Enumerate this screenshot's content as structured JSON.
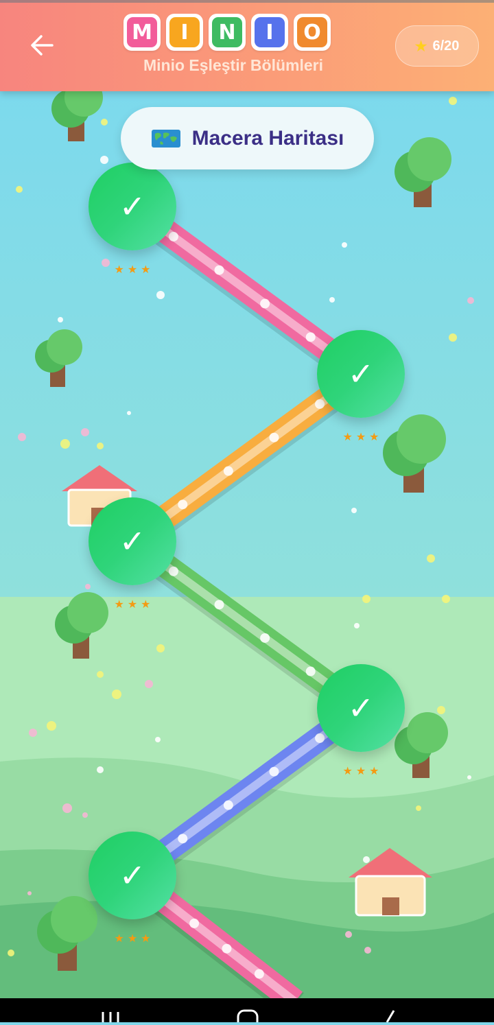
{
  "header": {
    "back_icon": "arrow-left-icon",
    "logo_letters": [
      {
        "letter": "M",
        "color": "#f25c9a"
      },
      {
        "letter": "I",
        "color": "#f8a61f"
      },
      {
        "letter": "N",
        "color": "#3ebb62"
      },
      {
        "letter": "I",
        "color": "#5672ec"
      },
      {
        "letter": "O",
        "color": "#f08a2e"
      }
    ],
    "subtitle": "Minio Eşleştir Bölümleri",
    "star_icon": "star-icon",
    "star_count": "6/20"
  },
  "map": {
    "title": "Macera Haritası",
    "title_icon": "world-map-icon"
  },
  "levels": [
    {
      "check": "✓",
      "stars": [
        "★",
        "★",
        "★"
      ],
      "completed": true
    },
    {
      "check": "✓",
      "stars": [
        "★",
        "★",
        "★"
      ],
      "completed": true
    },
    {
      "check": "✓",
      "stars": [
        "★",
        "★",
        "★"
      ],
      "completed": true
    },
    {
      "check": "✓",
      "stars": [
        "★",
        "★",
        "★"
      ],
      "completed": true
    },
    {
      "check": "✓",
      "stars": [
        "★",
        "★",
        "★"
      ],
      "completed": true
    }
  ],
  "path_colors": [
    "#f06aa0",
    "#f8ad3f",
    "#66c766",
    "#6d85f0",
    "#f06aa0"
  ],
  "colors": {
    "sky": "#7fd7ea",
    "meadow": "#a9e7b4",
    "node_green": "#2fd47a",
    "star_orange": "#f39b13",
    "title_text": "#3b2f86"
  }
}
